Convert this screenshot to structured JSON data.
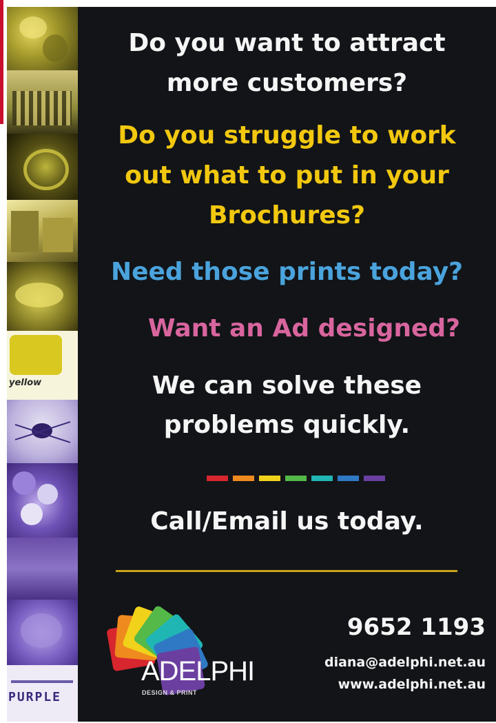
{
  "headline": {
    "line1": "Do you want to attract",
    "line2": "more customers?"
  },
  "question_brochures": {
    "line1": "Do you struggle to work",
    "line2": "out what to put in your",
    "line3": "Brochures?"
  },
  "question_prints": "Need those prints today?",
  "question_ad": "Want an Ad designed?",
  "solution": {
    "line1": "We can solve these",
    "line2": "problems quickly."
  },
  "call_to_action": "Call/Email us today.",
  "contact": {
    "phone": "9652 1193",
    "email": "diana@adelphi.net.au",
    "website": "www.adelphi.net.au"
  },
  "brand": {
    "name": "ADELPHI",
    "tagline": "DESIGN & PRINT"
  },
  "strip_labels": {
    "yellow": "yellow",
    "purple": "PURPLE"
  },
  "colors": {
    "background": "#121418",
    "yellow_text": "#f2c80f",
    "blue_text": "#4aa3dc",
    "pink_text": "#d8659e",
    "gold_rule": "#c9a41a",
    "rainbow": [
      "#d7262e",
      "#ef8a1e",
      "#f1d21b",
      "#54b948",
      "#1fb6b4",
      "#2f79c4",
      "#6b3fa0"
    ]
  }
}
